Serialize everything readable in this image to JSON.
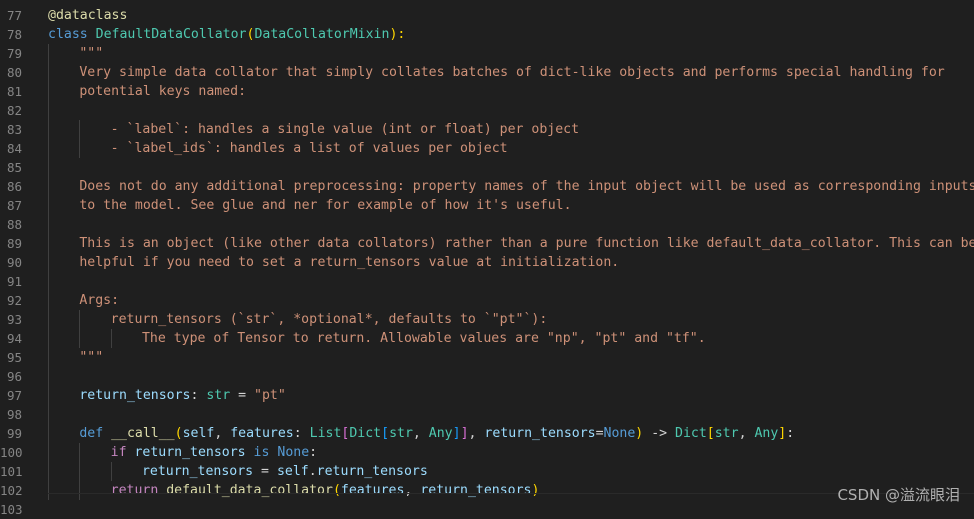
{
  "editor": {
    "lines": [
      {
        "n": "77",
        "indent": 0,
        "tokens": [
          [
            "@dataclass",
            "deco"
          ]
        ]
      },
      {
        "n": "78",
        "indent": 0,
        "tokens": [
          [
            "class ",
            "kw"
          ],
          [
            "DefaultDataCollator",
            "cls"
          ],
          [
            "(",
            "br1"
          ],
          [
            "DataCollatorMixin",
            "cls"
          ],
          [
            "):",
            "br1"
          ]
        ]
      },
      {
        "n": "79",
        "indent": 1,
        "tokens": [
          [
            "\"\"\"",
            "str"
          ]
        ]
      },
      {
        "n": "80",
        "indent": 1,
        "tokens": [
          [
            "Very simple data collator that simply collates batches of dict-like objects and performs special handling for",
            "str"
          ]
        ]
      },
      {
        "n": "81",
        "indent": 1,
        "tokens": [
          [
            "potential keys named:",
            "str"
          ]
        ]
      },
      {
        "n": "82",
        "indent": 1,
        "tokens": []
      },
      {
        "n": "83",
        "indent": 2,
        "tokens": [
          [
            "- `label`: handles a single value (int or float) per object",
            "str"
          ]
        ]
      },
      {
        "n": "84",
        "indent": 2,
        "tokens": [
          [
            "- `label_ids`: handles a list of values per object",
            "str"
          ]
        ]
      },
      {
        "n": "85",
        "indent": 1,
        "tokens": []
      },
      {
        "n": "86",
        "indent": 1,
        "tokens": [
          [
            "Does not do any additional preprocessing: property names of the input object will be used as corresponding inputs",
            "str"
          ]
        ]
      },
      {
        "n": "87",
        "indent": 1,
        "tokens": [
          [
            "to the model. See glue and ner for example of how it's useful.",
            "str"
          ]
        ]
      },
      {
        "n": "88",
        "indent": 1,
        "tokens": []
      },
      {
        "n": "89",
        "indent": 1,
        "tokens": [
          [
            "This is an object (like other data collators) rather than a pure function like default_data_collator. This can be",
            "str"
          ]
        ]
      },
      {
        "n": "90",
        "indent": 1,
        "tokens": [
          [
            "helpful if you need to set a return_tensors value at initialization.",
            "str"
          ]
        ]
      },
      {
        "n": "91",
        "indent": 1,
        "tokens": []
      },
      {
        "n": "92",
        "indent": 1,
        "tokens": [
          [
            "Args:",
            "str"
          ]
        ]
      },
      {
        "n": "93",
        "indent": 2,
        "tokens": [
          [
            "return_tensors (`str`, *optional*, defaults to `\"pt\"`):",
            "str"
          ]
        ]
      },
      {
        "n": "94",
        "indent": 3,
        "tokens": [
          [
            "The type of Tensor to return. Allowable values are \"np\", \"pt\" and \"tf\".",
            "str"
          ]
        ]
      },
      {
        "n": "95",
        "indent": 1,
        "tokens": [
          [
            "\"\"\"",
            "str"
          ]
        ]
      },
      {
        "n": "96",
        "indent": 1,
        "tokens": []
      },
      {
        "n": "97",
        "indent": 1,
        "tokens": [
          [
            "return_tensors",
            "var"
          ],
          [
            ": ",
            "op"
          ],
          [
            "str",
            "cls"
          ],
          [
            " = ",
            "op"
          ],
          [
            "\"pt\"",
            "str"
          ]
        ]
      },
      {
        "n": "98",
        "indent": 1,
        "tokens": []
      },
      {
        "n": "99",
        "indent": 1,
        "tokens": [
          [
            "def ",
            "kw"
          ],
          [
            "__call__",
            "fn"
          ],
          [
            "(",
            "br1"
          ],
          [
            "self",
            "var"
          ],
          [
            ", ",
            "op"
          ],
          [
            "features",
            "var"
          ],
          [
            ": ",
            "op"
          ],
          [
            "List",
            "cls"
          ],
          [
            "[",
            "br2"
          ],
          [
            "Dict",
            "cls"
          ],
          [
            "[",
            "br3"
          ],
          [
            "str",
            "cls"
          ],
          [
            ", ",
            "op"
          ],
          [
            "Any",
            "cls"
          ],
          [
            "]",
            "br3"
          ],
          [
            "]",
            "br2"
          ],
          [
            ", ",
            "op"
          ],
          [
            "return_tensors",
            "var"
          ],
          [
            "=",
            "op"
          ],
          [
            "None",
            "kw"
          ],
          [
            ")",
            "br1"
          ],
          [
            " -> ",
            "op"
          ],
          [
            "Dict",
            "cls"
          ],
          [
            "[",
            "br1"
          ],
          [
            "str",
            "cls"
          ],
          [
            ", ",
            "op"
          ],
          [
            "Any",
            "cls"
          ],
          [
            "]",
            "br1"
          ],
          [
            ":",
            "op"
          ]
        ]
      },
      {
        "n": "100",
        "indent": 2,
        "tokens": [
          [
            "if ",
            "ctrl"
          ],
          [
            "return_tensors",
            "var"
          ],
          [
            " is ",
            "kw"
          ],
          [
            "None",
            "kw"
          ],
          [
            ":",
            "op"
          ]
        ]
      },
      {
        "n": "101",
        "indent": 3,
        "tokens": [
          [
            "return_tensors",
            "var"
          ],
          [
            " = ",
            "op"
          ],
          [
            "self",
            "var"
          ],
          [
            ".",
            "op"
          ],
          [
            "return_tensors",
            "var"
          ]
        ]
      },
      {
        "n": "102",
        "indent": 2,
        "tokens": [
          [
            "return ",
            "ctrl"
          ],
          [
            "default_data_collator",
            "fn"
          ],
          [
            "(",
            "br1"
          ],
          [
            "features",
            "var"
          ],
          [
            ", ",
            "op"
          ],
          [
            "return_tensors",
            "var"
          ],
          [
            ")",
            "br1"
          ]
        ]
      },
      {
        "n": "103",
        "indent": 0,
        "tokens": []
      }
    ]
  },
  "watermark": "CSDN @溢流眼泪"
}
